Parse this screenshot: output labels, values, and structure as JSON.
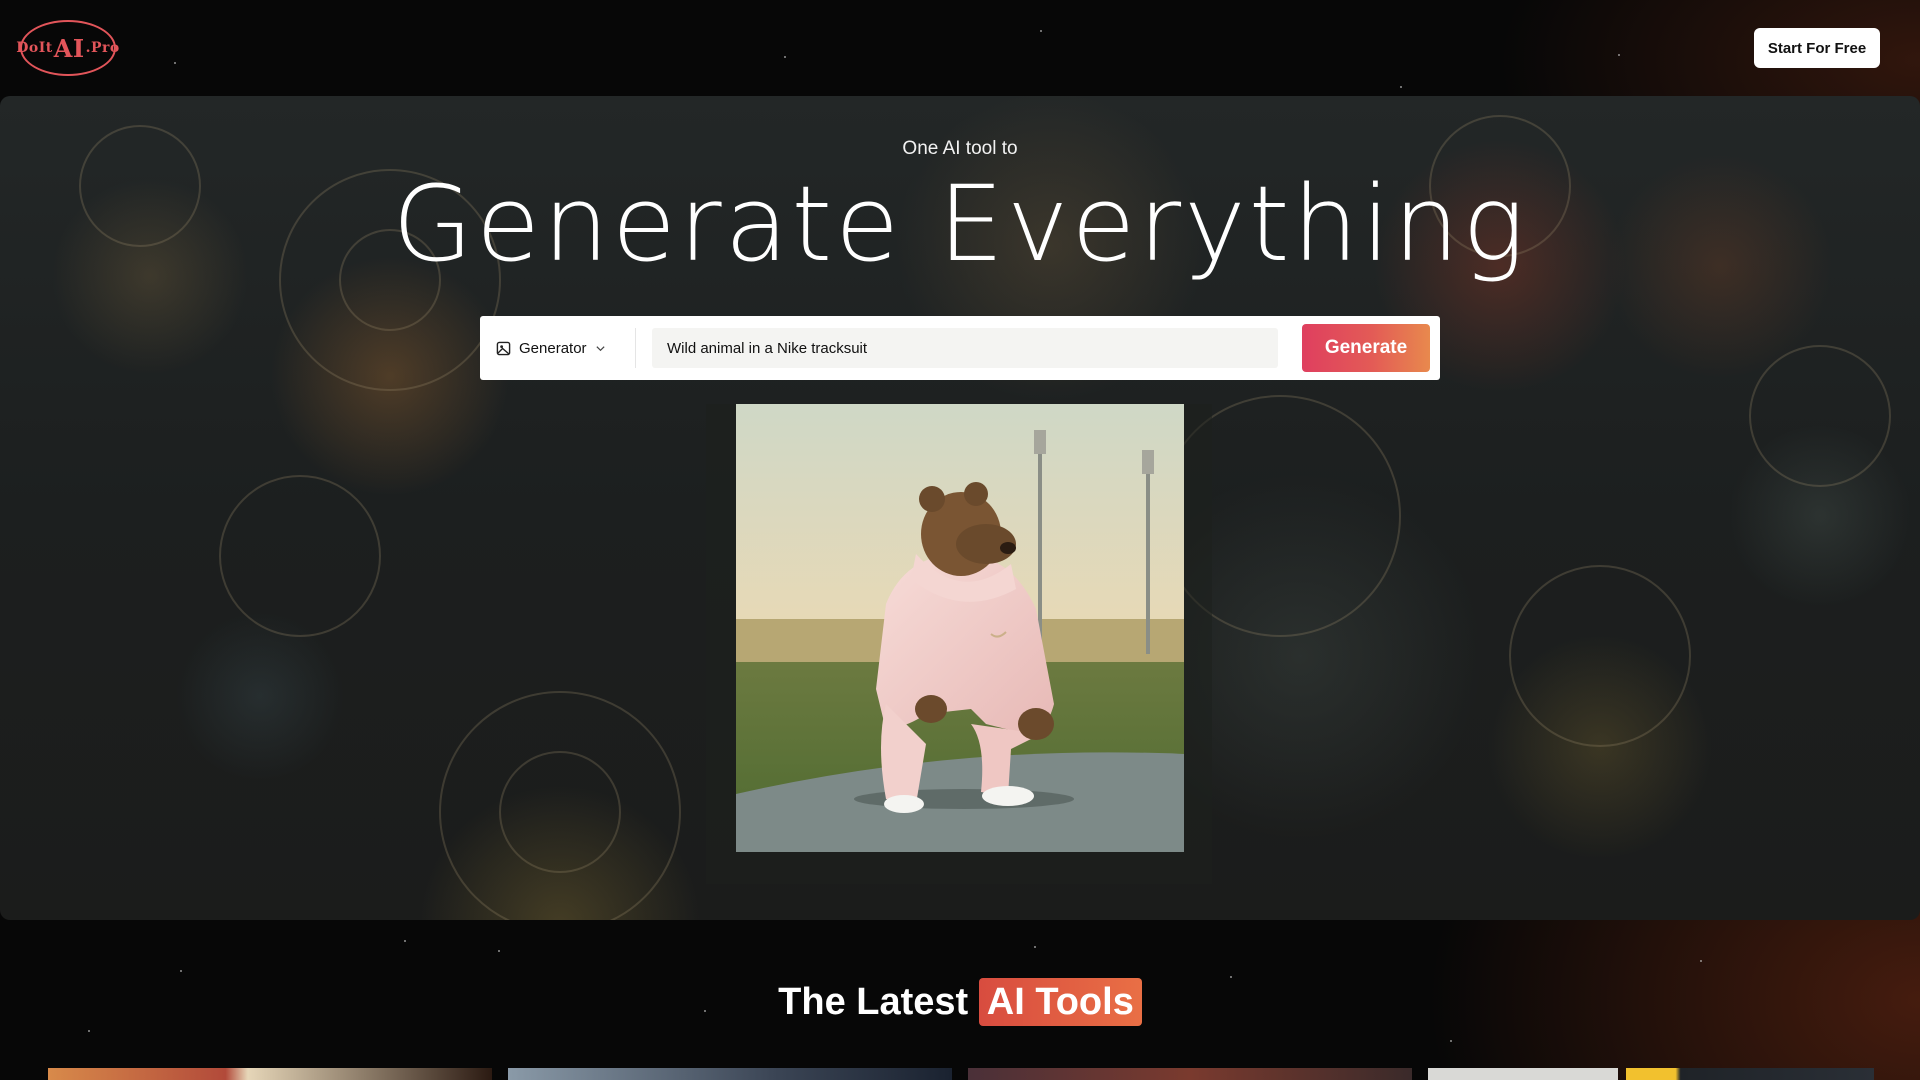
{
  "header": {
    "logo_text_left": "DoIt",
    "logo_text_big": "AI",
    "logo_text_right": ".Pro",
    "cta_label": "Start For Free"
  },
  "hero": {
    "subtitle": "One AI tool to",
    "title": "Generate Everything",
    "mode_select": {
      "icon": "image-icon",
      "value": "Generator"
    },
    "prompt_value": "Wild animal in a Nike tracksuit",
    "generate_label": "Generate",
    "carousel_image": "bear in pink tracksuit crouching on a sports field at sunset"
  },
  "section": {
    "title_prefix": "The Latest",
    "title_highlight": "AI Tools"
  },
  "colors": {
    "brand": "#e2555a",
    "generate_gradient_start": "#df3f5f",
    "generate_gradient_end": "#e8894d",
    "highlight": "#dd5640"
  }
}
